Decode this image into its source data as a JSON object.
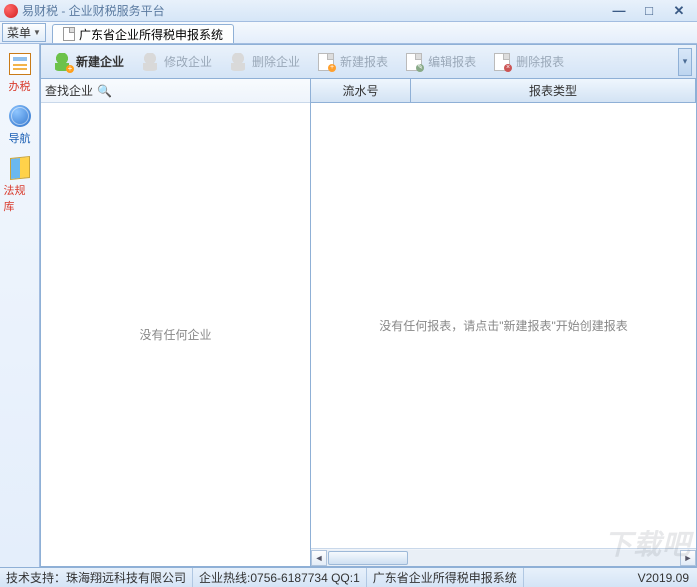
{
  "window": {
    "title": "易财税 - 企业财税服务平台"
  },
  "menubar": {
    "menu_label": "菜单",
    "tab_label": "广东省企业所得税申报系统"
  },
  "sidebar": {
    "items": [
      {
        "label": "办税"
      },
      {
        "label": "导航"
      },
      {
        "label": "法规库"
      }
    ]
  },
  "toolbar": {
    "new_company": "新建企业",
    "edit_company": "修改企业",
    "delete_company": "删除企业",
    "new_report": "新建报表",
    "edit_report": "编辑报表",
    "delete_report": "删除报表"
  },
  "search": {
    "label": "查找企业",
    "value": ""
  },
  "left_empty": "没有任何企业",
  "table": {
    "col1": "流水号",
    "col2": "报表类型"
  },
  "right_empty": "没有任何报表，请点击\"新建报表\"开始创建报表",
  "status": {
    "support": "技术支持：珠海翔远科技有限公司",
    "contact": "企业热线:0756-6187734 QQ:1",
    "context": "广东省企业所得税申报系统",
    "version": "V2019.09"
  },
  "watermark": "下载吧"
}
